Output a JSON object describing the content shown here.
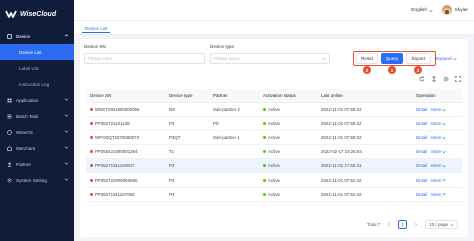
{
  "app": {
    "brand": "WiseCloud"
  },
  "sidebar": {
    "items": [
      {
        "label": "Device",
        "icon": "device-icon",
        "open": true,
        "children": [
          {
            "label": "Device List",
            "active": true
          },
          {
            "label": "Label List",
            "active": false
          },
          {
            "label": "Instruction Log",
            "active": false
          }
        ]
      },
      {
        "label": "Application",
        "icon": "application-icon"
      },
      {
        "label": "Batch Task",
        "icon": "batch-icon"
      },
      {
        "label": "WiseOS",
        "icon": "os-icon"
      },
      {
        "label": "Merchant",
        "icon": "merchant-icon"
      },
      {
        "label": "Partner",
        "icon": "partner-icon"
      },
      {
        "label": "System Setting",
        "icon": "settings-icon"
      }
    ]
  },
  "header": {
    "language": "English",
    "user_name": "Skylar"
  },
  "tabs": [
    {
      "label": "Device List"
    }
  ],
  "filters": {
    "sn_label": "Device SN",
    "sn_placeholder": "Please enter",
    "type_label": "Device type",
    "type_placeholder": "Please select"
  },
  "actions": {
    "reset": "Reset",
    "query": "Query",
    "export": "Export",
    "expand": "Expand",
    "badges": [
      "2",
      "1",
      "3"
    ]
  },
  "table": {
    "columns": [
      "Device SN",
      "Device type",
      "Partner",
      "Activation status",
      "Last online",
      "Operation"
    ],
    "rows": [
      {
        "sn": "WNETSW1800000066",
        "type": "NS",
        "partner": "Sub-partner 2",
        "status": "Active",
        "online": "2022-11-01 07:50:22"
      },
      {
        "sn": "PP352721101138",
        "type": "P3",
        "partner": "Plz",
        "status": "Active",
        "online": "2022-11-01 07:50:22"
      },
      {
        "sn": "WPOSQT2070000073",
        "type": "P3QT",
        "partner": "Sub-partner 1",
        "status": "Active",
        "online": "2022-11-01 07:50:22"
      },
      {
        "sn": "PP355421080001264",
        "type": "T1",
        "partner": "",
        "status": "Active",
        "online": "2022-02-17 15:26:54"
      },
      {
        "sn": "PP35271911100847",
        "type": "P3",
        "partner": "",
        "status": "Active",
        "online": "2022-11-01 17:52:41"
      },
      {
        "sn": "PP352722090062660",
        "type": "P3",
        "partner": "",
        "status": "Active",
        "online": "2022-11-01 07:52:42"
      },
      {
        "sn": "PP35271911107058",
        "type": "P3",
        "partner": "",
        "status": "Active",
        "online": "2022-11-01 07:52:42"
      }
    ],
    "op_detail": "Detail",
    "op_more": "More"
  },
  "pagination": {
    "total": "Total 7",
    "page": "1",
    "page_size": "10 / page"
  },
  "colors": {
    "sidebar": "#0f1d3a",
    "accent": "#2c6cf2",
    "badge": "#e8502f",
    "active": "#52c41a"
  }
}
